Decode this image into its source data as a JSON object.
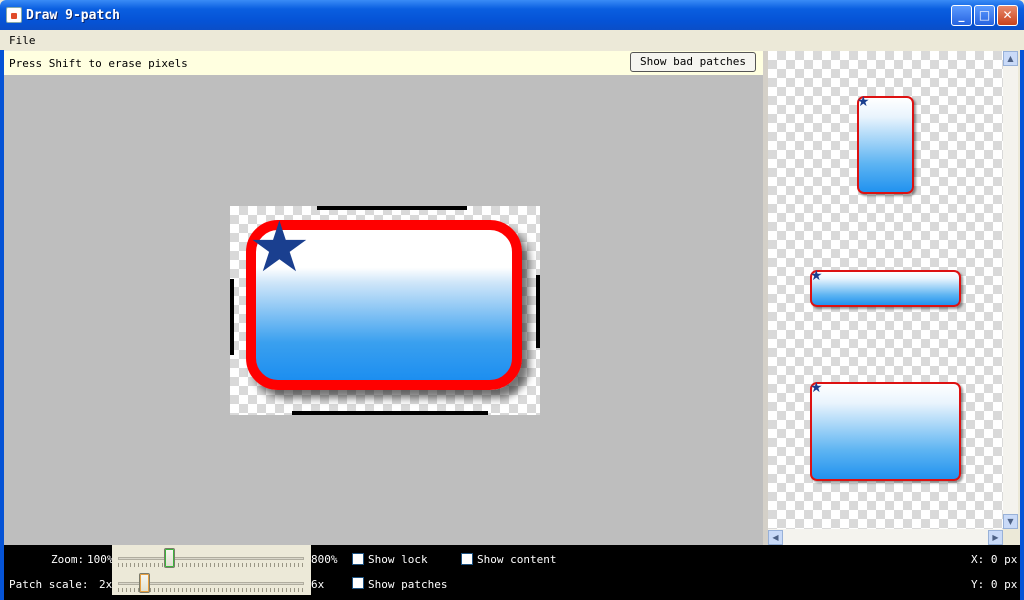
{
  "window": {
    "title": "Draw 9-patch"
  },
  "menu": {
    "items": [
      "File"
    ]
  },
  "toolbar": {
    "hint": "Press Shift to erase pixels",
    "show_bad_patches": "Show bad patches"
  },
  "controls": {
    "zoom_label": "Zoom:",
    "zoom_min": "100%",
    "zoom_max": "800%",
    "zoom_value_fraction": 0.26,
    "patch_scale_label": "Patch scale:",
    "patch_scale_min": "2x",
    "patch_scale_max": "6x",
    "patch_scale_value_fraction": 0.12,
    "show_lock": "Show lock",
    "show_patches": "Show patches",
    "show_content": "Show content",
    "x_readout": "X: 0 px",
    "y_readout": "Y: 0 px"
  },
  "icons": {
    "app": "java-app-icon",
    "minimize": "minimize-icon",
    "maximize": "maximize-icon",
    "close": "close-icon",
    "star": "star-icon"
  },
  "colors": {
    "titlebar": "#0a5fe0",
    "patch_border": "#ff0000",
    "star": "#1a3f8f",
    "gradient_bottom": "#1c8ef0"
  }
}
